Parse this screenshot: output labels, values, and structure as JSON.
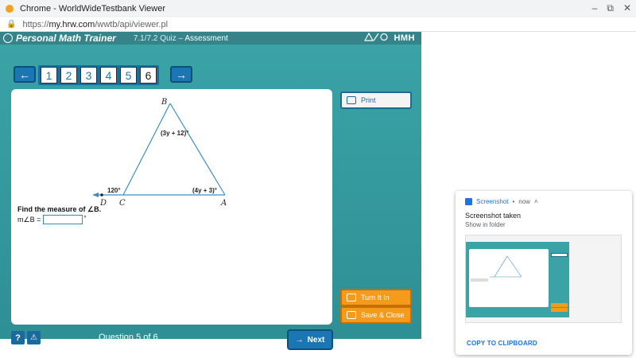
{
  "window": {
    "title": "Chrome - WorldWideTestbank Viewer",
    "minimize_glyph": "–",
    "maximize_glyph": "⧉",
    "close_glyph": "✕"
  },
  "address": {
    "scheme": "https://",
    "host": "my.hrw.com",
    "path": "/wwtb/api/viewer.pl"
  },
  "header": {
    "brand": "Personal Math Trainer",
    "quiz_code": "7.1/7.2 Quiz",
    "quiz_separator": " – ",
    "quiz_kind": "Assessment",
    "publisher": "HMH"
  },
  "nav": {
    "prev_glyph": "←",
    "next_glyph": "→",
    "questions": [
      "1",
      "2",
      "3",
      "4",
      "5",
      "6"
    ],
    "current": 5,
    "status_colors": {
      "answered": "#1a77b4"
    }
  },
  "figure": {
    "vertex_B": "B",
    "vertex_C": "C",
    "vertex_D": "D",
    "vertex_A": "A",
    "label_B": "(3y + 12)°",
    "label_C": "120°",
    "label_A": "(4y + 3)°"
  },
  "question": {
    "prompt": "Find the measure of ∠B.",
    "answer_label": "m∠B =",
    "answer_value": "",
    "unit": "°"
  },
  "side": {
    "print_label": "Print",
    "turn_in_label": "Turn It In",
    "save_close_label": "Save & Close"
  },
  "footer": {
    "help_glyph": "?",
    "warn_glyph": "⚠",
    "question_counter": "Question 5 of 6",
    "next_label": "Next",
    "next_glyph": "→"
  },
  "notification": {
    "app": "Screenshot",
    "dot": "•",
    "time": "now",
    "chevron": "˄",
    "title": "Screenshot taken",
    "subtitle": "Show in folder",
    "action": "COPY TO CLIPBOARD"
  }
}
